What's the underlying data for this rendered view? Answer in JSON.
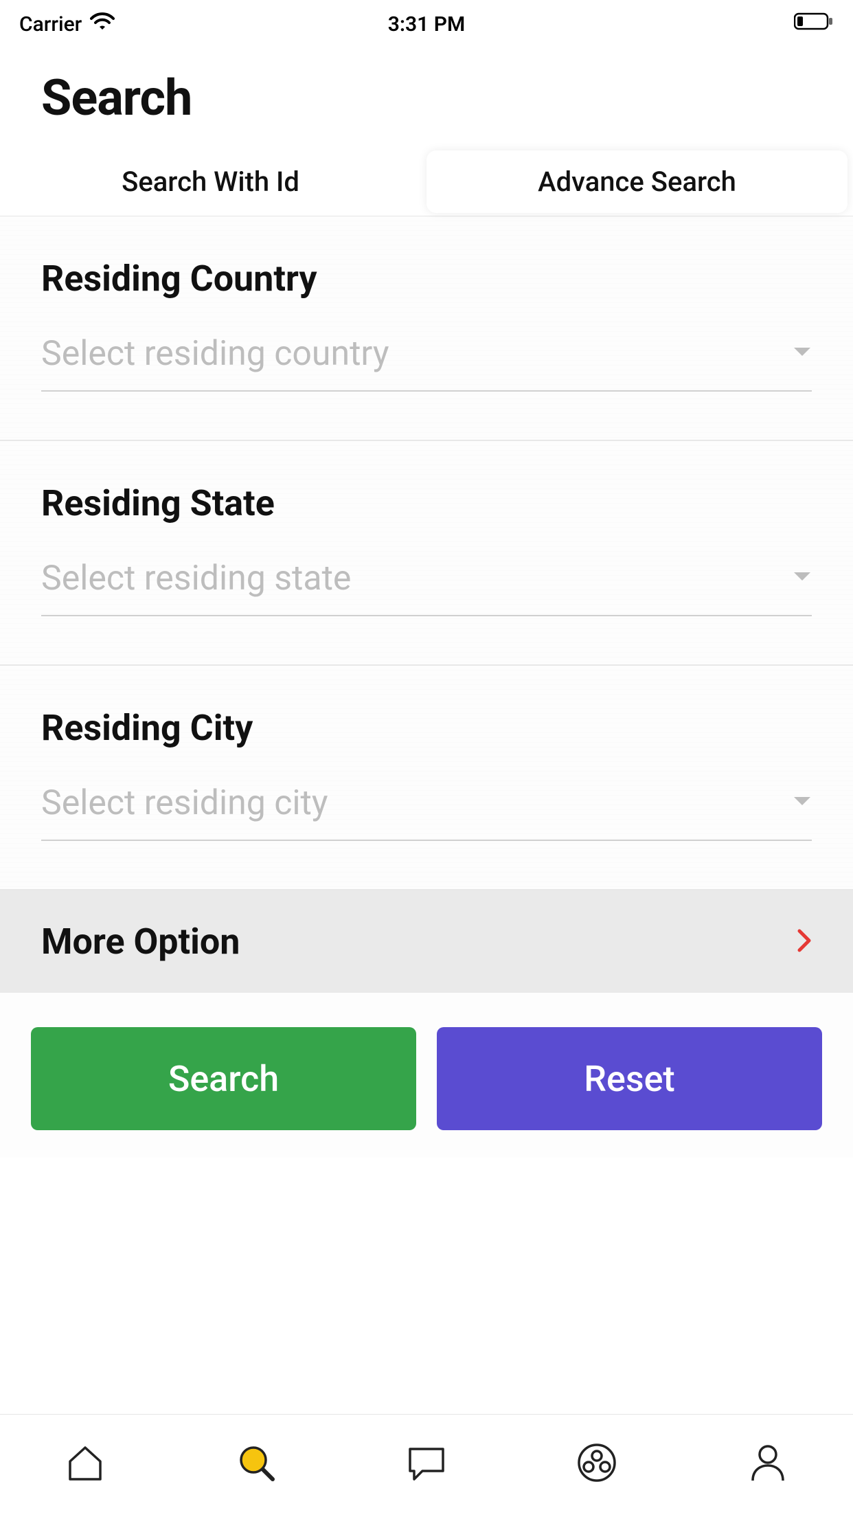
{
  "status": {
    "carrier": "Carrier",
    "time": "3:31 PM"
  },
  "title": "Search",
  "tabs": {
    "searchWithId": "Search With Id",
    "advanceSearch": "Advance Search"
  },
  "fields": {
    "country": {
      "label": "Residing Country",
      "placeholder": "Select residing country"
    },
    "state": {
      "label": "Residing State",
      "placeholder": "Select residing state"
    },
    "city": {
      "label": "Residing City",
      "placeholder": "Select residing city"
    }
  },
  "moreOption": "More Option",
  "buttons": {
    "search": "Search",
    "reset": "Reset"
  }
}
